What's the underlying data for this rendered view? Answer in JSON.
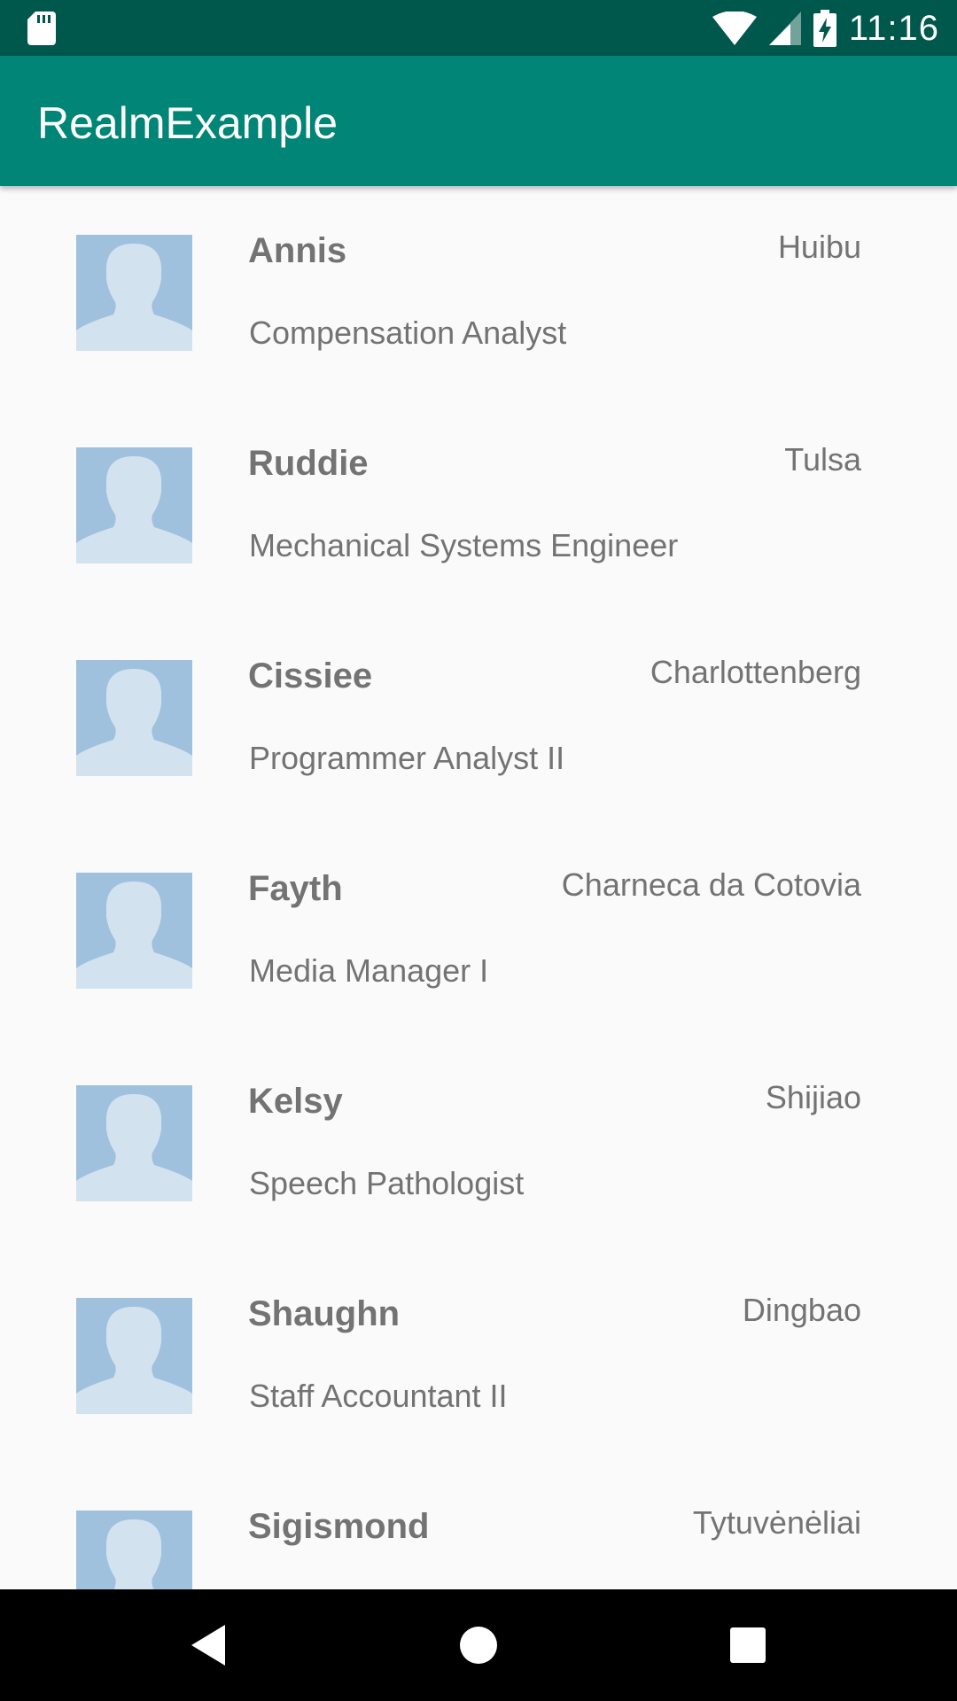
{
  "status_bar": {
    "time": "11:16",
    "icons": [
      "sd-card-icon",
      "wifi-icon",
      "cell-signal-icon",
      "battery-charging-icon"
    ]
  },
  "app_bar": {
    "title": "RealmExample"
  },
  "list": {
    "items": [
      {
        "name": "Annis",
        "city": "Huibu",
        "job": "Compensation Analyst"
      },
      {
        "name": "Ruddie",
        "city": "Tulsa",
        "job": "Mechanical Systems Engineer"
      },
      {
        "name": "Cissiee",
        "city": "Charlottenberg",
        "job": "Programmer Analyst II"
      },
      {
        "name": "Fayth",
        "city": "Charneca da Cotovia",
        "job": "Media Manager I"
      },
      {
        "name": "Kelsy",
        "city": "Shijiao",
        "job": "Speech Pathologist"
      },
      {
        "name": "Shaughn",
        "city": "Dingbao",
        "job": "Staff Accountant II"
      },
      {
        "name": "Sigismond",
        "city": "Tytuvėnėliai",
        "job": ""
      }
    ]
  },
  "nav_bar": {
    "buttons": [
      "back-icon",
      "home-icon",
      "recents-icon"
    ]
  },
  "colors": {
    "status_bar": "#00574b",
    "app_bar": "#008577",
    "text_gray": "#737373",
    "avatar_bg": "#a0c1dd",
    "avatar_figure": "#d3e2ef"
  }
}
